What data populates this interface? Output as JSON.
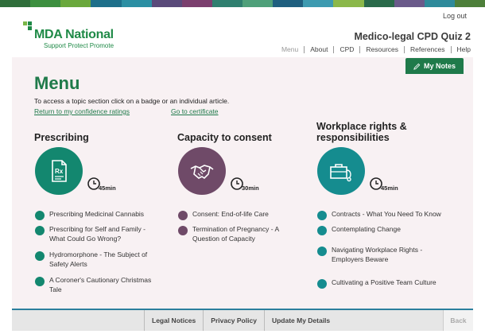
{
  "header": {
    "logout_label": "Log out",
    "logo_name": "MDA National",
    "logo_tagline": "Support Protect Promote",
    "quiz_title": "Medico-legal CPD Quiz 2",
    "nav": [
      "Menu",
      "About",
      "CPD",
      "Resources",
      "References",
      "Help"
    ],
    "my_notes_label": "My Notes"
  },
  "colors": {
    "brand_green": "#1f7a4a",
    "prescribing": "#13876f",
    "capacity": "#6f4a68",
    "workplace": "#158c8f",
    "footer_accent": "#2b7f9d"
  },
  "main": {
    "title": "Menu",
    "intro": "To access a topic section click on a badge or an individual article.",
    "link_confidence": "Return to my confidence ratings",
    "link_certificate": "Go to certificate"
  },
  "sections": [
    {
      "title": "Prescribing",
      "icon": "prescription-document-icon",
      "duration": "45min",
      "articles": [
        "Prescribing Medicinal Cannabis",
        "Prescribing for Self and Family - What Could Go Wrong?",
        "Hydromorphone - The Subject of Safety Alerts",
        "A Coroner's Cautionary Christmas Tale"
      ]
    },
    {
      "title": "Capacity to consent",
      "icon": "handshake-icon",
      "duration": "30min",
      "articles": [
        "Consent: End-of-life Care",
        "Termination of Pregnancy - A Question of Capacity"
      ]
    },
    {
      "title": "Workplace rights & responsibilities",
      "icon": "briefcase-stethoscope-icon",
      "duration": "45min",
      "articles": [
        "Contracts - What You Need To Know",
        "Contemplating Change",
        "Navigating Workplace Rights - Employers Beware",
        "Cultivating a Positive Team Culture"
      ]
    }
  ],
  "footer": {
    "items": [
      "Legal Notices",
      "Privacy Policy",
      "Update My Details"
    ],
    "back_label": "Back"
  }
}
